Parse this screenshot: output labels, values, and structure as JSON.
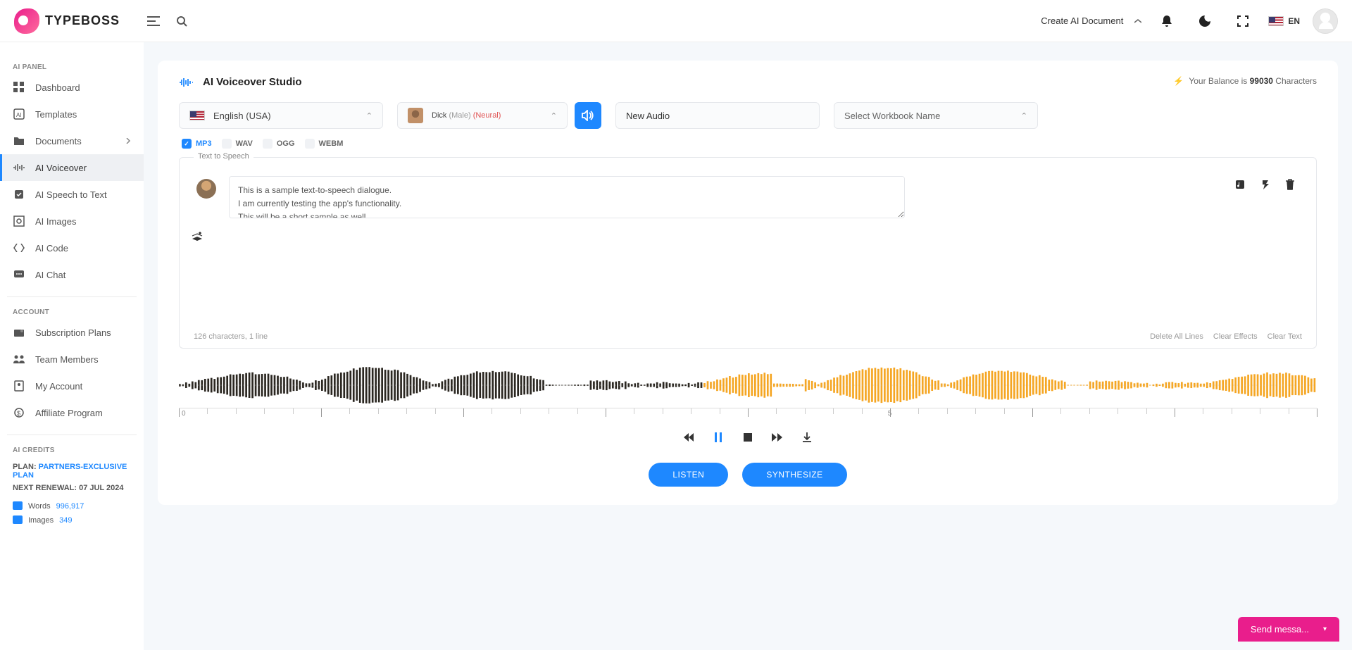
{
  "brand": "TYPEBOSS",
  "header": {
    "create_doc": "Create AI Document",
    "lang": "EN"
  },
  "sidebar": {
    "section1": "AI PANEL",
    "items1": [
      {
        "label": "Dashboard"
      },
      {
        "label": "Templates"
      },
      {
        "label": "Documents",
        "expand": true
      },
      {
        "label": "AI Voiceover",
        "active": true
      },
      {
        "label": "AI Speech to Text"
      },
      {
        "label": "AI Images"
      },
      {
        "label": "AI Code"
      },
      {
        "label": "AI Chat"
      }
    ],
    "section2": "ACCOUNT",
    "items2": [
      {
        "label": "Subscription Plans"
      },
      {
        "label": "Team Members"
      },
      {
        "label": "My Account"
      },
      {
        "label": "Affiliate Program"
      }
    ],
    "section3": "AI CREDITS",
    "plan_label": "PLAN:",
    "plan_value": "PARTNERS-EXCLUSIVE PLAN",
    "renewal_label": "NEXT RENEWAL:",
    "renewal_value": "07 JUL 2024",
    "credits": [
      {
        "label": "Words",
        "value": "996,917"
      },
      {
        "label": "Images",
        "value": "349"
      }
    ]
  },
  "studio": {
    "title": "AI Voiceover Studio",
    "balance_prefix": "Your Balance is ",
    "balance_value": "99030",
    "balance_suffix": " Characters",
    "language": "English (USA)",
    "voice_name": "Dick",
    "voice_gender": "(Male)",
    "voice_type": "(Neural)",
    "audio_name": "New Audio",
    "workbook_placeholder": "Select Workbook Name",
    "formats": [
      "MP3",
      "WAV",
      "OGG",
      "WEBM"
    ],
    "format_selected": "MP3",
    "tts_legend": "Text to Speech",
    "tts_text": "This is a sample text-to-speech dialogue.\nI am currently testing the app's functionality.\nThis will be a short sample as well.",
    "char_count": "126 characters, 1 line",
    "footer_links": [
      "Delete All Lines",
      "Clear Effects",
      "Clear Text"
    ],
    "timeline": {
      "start": "0",
      "mid": "5"
    },
    "btn_listen": "LISTEN",
    "btn_synth": "SYNTHESIZE"
  },
  "chat": {
    "label": "Send messa..."
  }
}
